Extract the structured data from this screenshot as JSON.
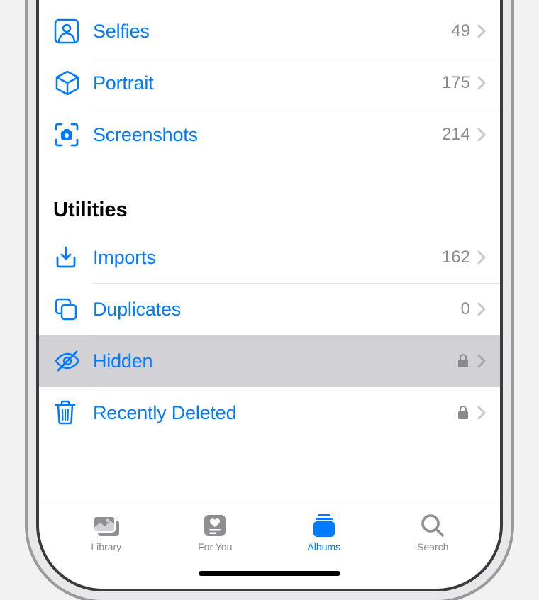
{
  "colors": {
    "accent": "#007aff",
    "gray": "#8a8a8e"
  },
  "mediaTypes": [
    {
      "icon": "person-square-icon",
      "label": "Selfies",
      "count": "49"
    },
    {
      "icon": "cube-icon",
      "label": "Portrait",
      "count": "175"
    },
    {
      "icon": "camera-viewfinder-icon",
      "label": "Screenshots",
      "count": "214"
    }
  ],
  "utilities": {
    "header": "Utilities",
    "items": [
      {
        "icon": "import-icon",
        "label": "Imports",
        "count": "162",
        "locked": false,
        "selected": false
      },
      {
        "icon": "duplicate-icon",
        "label": "Duplicates",
        "count": "0",
        "locked": false,
        "selected": false
      },
      {
        "icon": "eye-slash-icon",
        "label": "Hidden",
        "count": "",
        "locked": true,
        "selected": true
      },
      {
        "icon": "trash-icon",
        "label": "Recently Deleted",
        "count": "",
        "locked": true,
        "selected": false
      }
    ]
  },
  "tabs": [
    {
      "icon": "library-tab-icon",
      "label": "Library",
      "active": false
    },
    {
      "icon": "foryou-tab-icon",
      "label": "For You",
      "active": false
    },
    {
      "icon": "albums-tab-icon",
      "label": "Albums",
      "active": true
    },
    {
      "icon": "search-tab-icon",
      "label": "Search",
      "active": false
    }
  ]
}
